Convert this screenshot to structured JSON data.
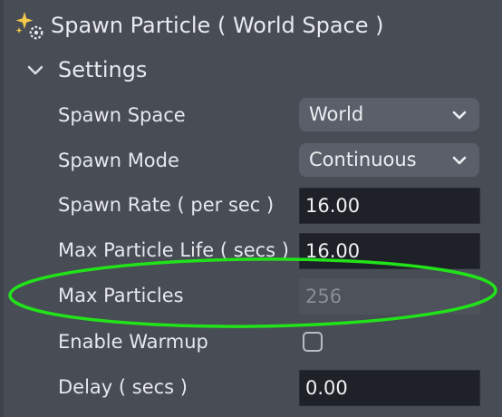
{
  "header": {
    "title": "Spawn Particle ( World Space )",
    "icon": "sparkle-gear-icon"
  },
  "section": {
    "label": "Settings",
    "expanded": true
  },
  "fields": {
    "spawn_space": {
      "label": "Spawn Space",
      "value": "World"
    },
    "spawn_mode": {
      "label": "Spawn Mode",
      "value": "Continuous"
    },
    "spawn_rate": {
      "label": "Spawn Rate ( per sec )",
      "value": "16.00"
    },
    "max_particle_life": {
      "label": "Max Particle Life ( secs )",
      "value": "16.00"
    },
    "max_particles": {
      "label": "Max Particles",
      "value": "256",
      "disabled": true
    },
    "enable_warmup": {
      "label": "Enable Warmup",
      "checked": false
    },
    "delay": {
      "label": "Delay ( secs )",
      "value": "0.00"
    }
  },
  "annotation": {
    "color": "#22e21a",
    "target": "max-particles-row"
  },
  "colors": {
    "panel_bg": "#474c55",
    "input_bg": "#1e2127",
    "dropdown_bg": "#5a5f69",
    "icon_yellow": "#f2c94c"
  }
}
